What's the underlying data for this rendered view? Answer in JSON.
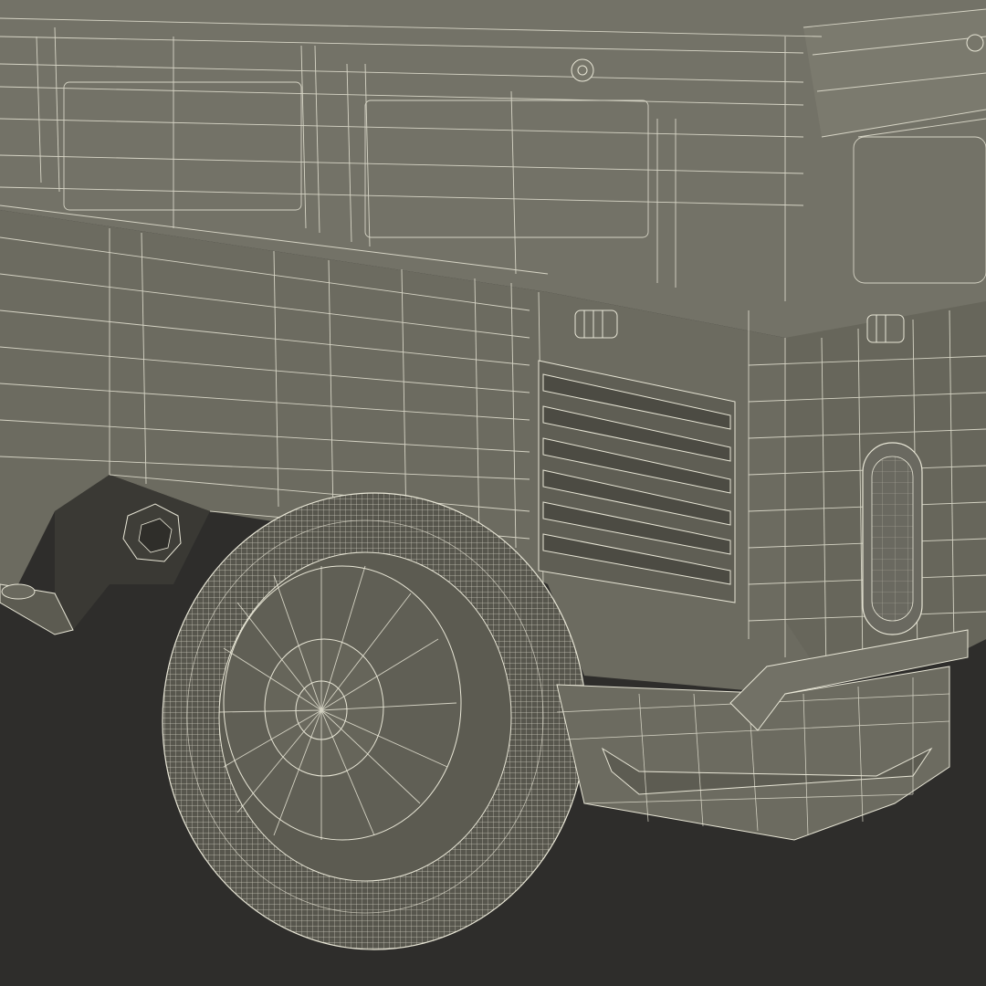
{
  "colors": {
    "background": "#2e2d2b",
    "body_fill": "#6f6e63",
    "body_shadow": "#5a594f",
    "wire": "#e8e6d6",
    "tire": "#55544b",
    "dark_cavity": "#3a3934"
  },
  "subject": {
    "icon": "vehicle-rear-wireframe-icon"
  }
}
